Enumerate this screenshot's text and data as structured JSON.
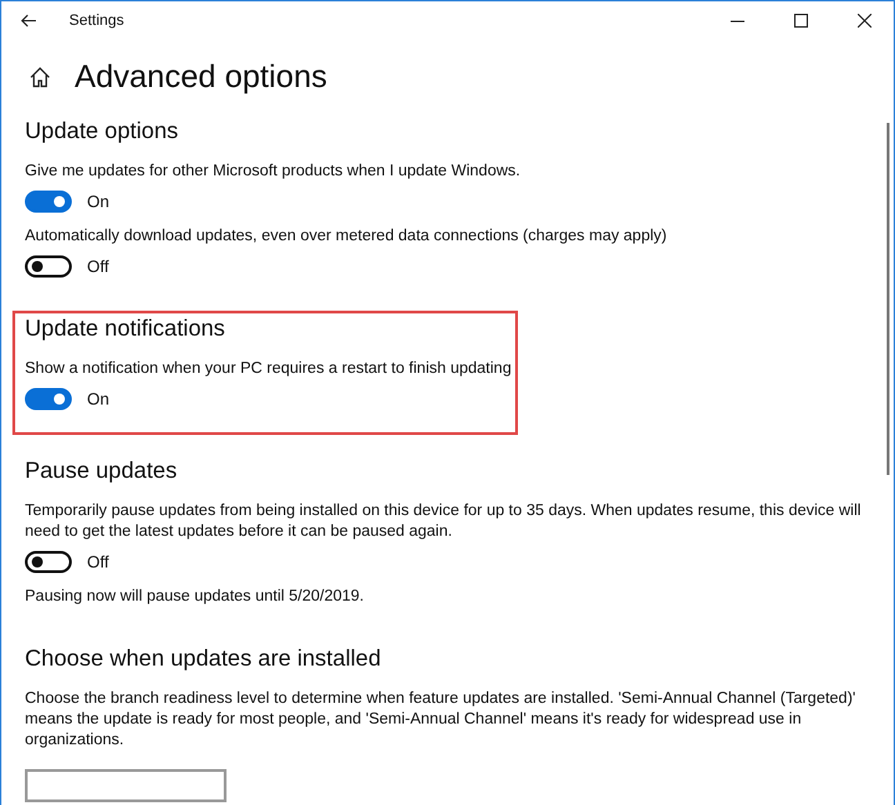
{
  "window": {
    "title": "Settings"
  },
  "page_title": "Advanced options",
  "sections": [
    {
      "title": "Update options",
      "highlighted": false,
      "items": [
        {
          "kind": "toggle",
          "label": "Give me updates for other Microsoft products when I update Windows.",
          "on": true,
          "state_text": "On"
        },
        {
          "kind": "toggle",
          "label": "Automatically download updates, even over metered data connections (charges may apply)",
          "on": false,
          "state_text": "Off"
        }
      ]
    },
    {
      "title": "Update notifications",
      "highlighted": true,
      "items": [
        {
          "kind": "toggle",
          "label": "Show a notification when your PC requires a restart to finish updating",
          "on": true,
          "state_text": "On"
        }
      ]
    },
    {
      "title": "Pause updates",
      "highlighted": false,
      "items": [
        {
          "kind": "toggle",
          "label": "Temporarily pause updates from being installed on this device for up to 35 days. When updates resume, this device will need to get the latest updates before it can be paused again.",
          "on": false,
          "state_text": "Off"
        },
        {
          "kind": "note",
          "text": "Pausing now will pause updates until 5/20/2019."
        }
      ]
    },
    {
      "title": "Choose when updates are installed",
      "highlighted": false,
      "items": [
        {
          "kind": "note",
          "text": "Choose the branch readiness level to determine when feature updates are installed. 'Semi-Annual Channel (Targeted)' means the update is ready for most people, and 'Semi-Annual Channel' means it's ready for widespread use in organizations."
        },
        {
          "kind": "dropdown"
        }
      ]
    }
  ]
}
